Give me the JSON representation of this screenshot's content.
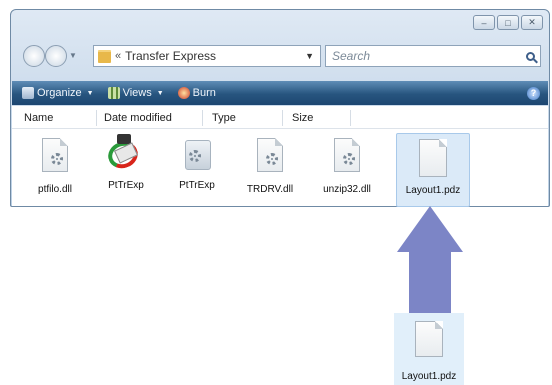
{
  "window": {
    "controls": {
      "minimize": "–",
      "maximize": "□",
      "close": "✕"
    }
  },
  "navigation": {
    "breadcrumb_prefix": "«",
    "breadcrumb": "Transfer Express",
    "search_placeholder": "Search"
  },
  "toolbar": {
    "organize_label": "Organize",
    "views_label": "Views",
    "burn_label": "Burn",
    "help_symbol": "?"
  },
  "columns": [
    "Name",
    "Date modified",
    "Type",
    "Size"
  ],
  "files": [
    {
      "name": "ptfilo.dll",
      "icon": "dll-gear-icon"
    },
    {
      "name": "PtTrExp",
      "icon": "transfer-express-app-icon"
    },
    {
      "name": "PtTrExp",
      "icon": "transfer-express-config-icon"
    },
    {
      "name": "TRDRV.dll",
      "icon": "dll-gear-icon"
    },
    {
      "name": "unzip32.dll",
      "icon": "dll-gear-icon"
    },
    {
      "name": "Layout1.pdz",
      "icon": "document-icon",
      "selected": true
    }
  ],
  "dragged_file": {
    "name": "Layout1.pdz",
    "icon": "document-icon"
  },
  "colors": {
    "arrow": "#7c85c6",
    "toolbar": "#27557f",
    "selection": "#dbeaf8"
  }
}
